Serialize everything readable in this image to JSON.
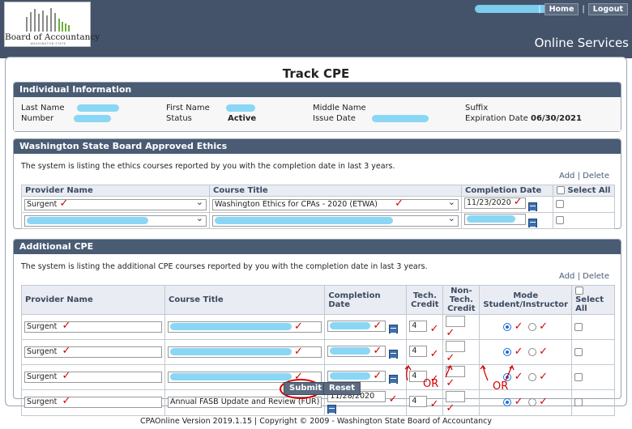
{
  "header": {
    "logo_text": "Board of Accountancy",
    "logo_subtext": "WASHINGTON STATE",
    "home_label": "Home",
    "logout_label": "Logout",
    "separator": "|",
    "subtitle": "Online Services"
  },
  "page_title": "Track CPE",
  "individual": {
    "heading": "Individual Information",
    "last_name_label": "Last Name",
    "first_name_label": "First Name",
    "middle_name_label": "Middle Name",
    "suffix_label": "Suffix",
    "number_label": "Number",
    "status_label": "Status",
    "status_value": "Active",
    "issue_date_label": "Issue Date",
    "expiration_label": "Expiration Date",
    "expiration_value": "06/30/2021"
  },
  "ethics": {
    "heading": "Washington State Board Approved Ethics",
    "note": "The system is listing the ethics courses reported by you with the completion date in last 3 years.",
    "add_label": "Add",
    "delete_label": "Delete",
    "col_provider": "Provider Name",
    "col_course": "Course Title",
    "col_date": "Completion Date",
    "col_select": "Select All",
    "rows": [
      {
        "provider": "Surgent",
        "course": "Washington Ethics for CPAs - 2020 (ETWA)",
        "date": "11/23/2020"
      },
      {
        "provider": "",
        "course": "",
        "date": ""
      }
    ]
  },
  "additional": {
    "heading": "Additional CPE",
    "note": "The system is listing the additional CPE courses reported by you with the completion date in last 3 years.",
    "add_label": "Add",
    "delete_label": "Delete",
    "col_provider": "Provider Name",
    "col_course": "Course Title",
    "col_date": "Completion Date",
    "col_tech": "Tech. Credit",
    "col_nontech": "Non-Tech. Credit",
    "col_mode": "Mode Student/Instructor",
    "col_select": "Select All",
    "rows": [
      {
        "provider": "Surgent",
        "course": "",
        "date": "",
        "tech": "4",
        "nontech": ""
      },
      {
        "provider": "Surgent",
        "course": "",
        "date": "",
        "tech": "4",
        "nontech": ""
      },
      {
        "provider": "Surgent",
        "course": "",
        "date": "",
        "tech": "4",
        "nontech": ""
      },
      {
        "provider": "Surgent",
        "course": "Annual FASB Update and Review (FUR)",
        "date": "11/28/2020",
        "tech": "4",
        "nontech": ""
      }
    ]
  },
  "buttons": {
    "submit_label": "Submit",
    "reset_label": "Reset"
  },
  "annotations": {
    "or1": "OR",
    "or2": "OR",
    "checkmark": "✓",
    "color": "#d40000"
  },
  "footer": "CPAOnline Version 2019.1.15 | Copyright © 2009 - Washington State Board of Accountancy"
}
